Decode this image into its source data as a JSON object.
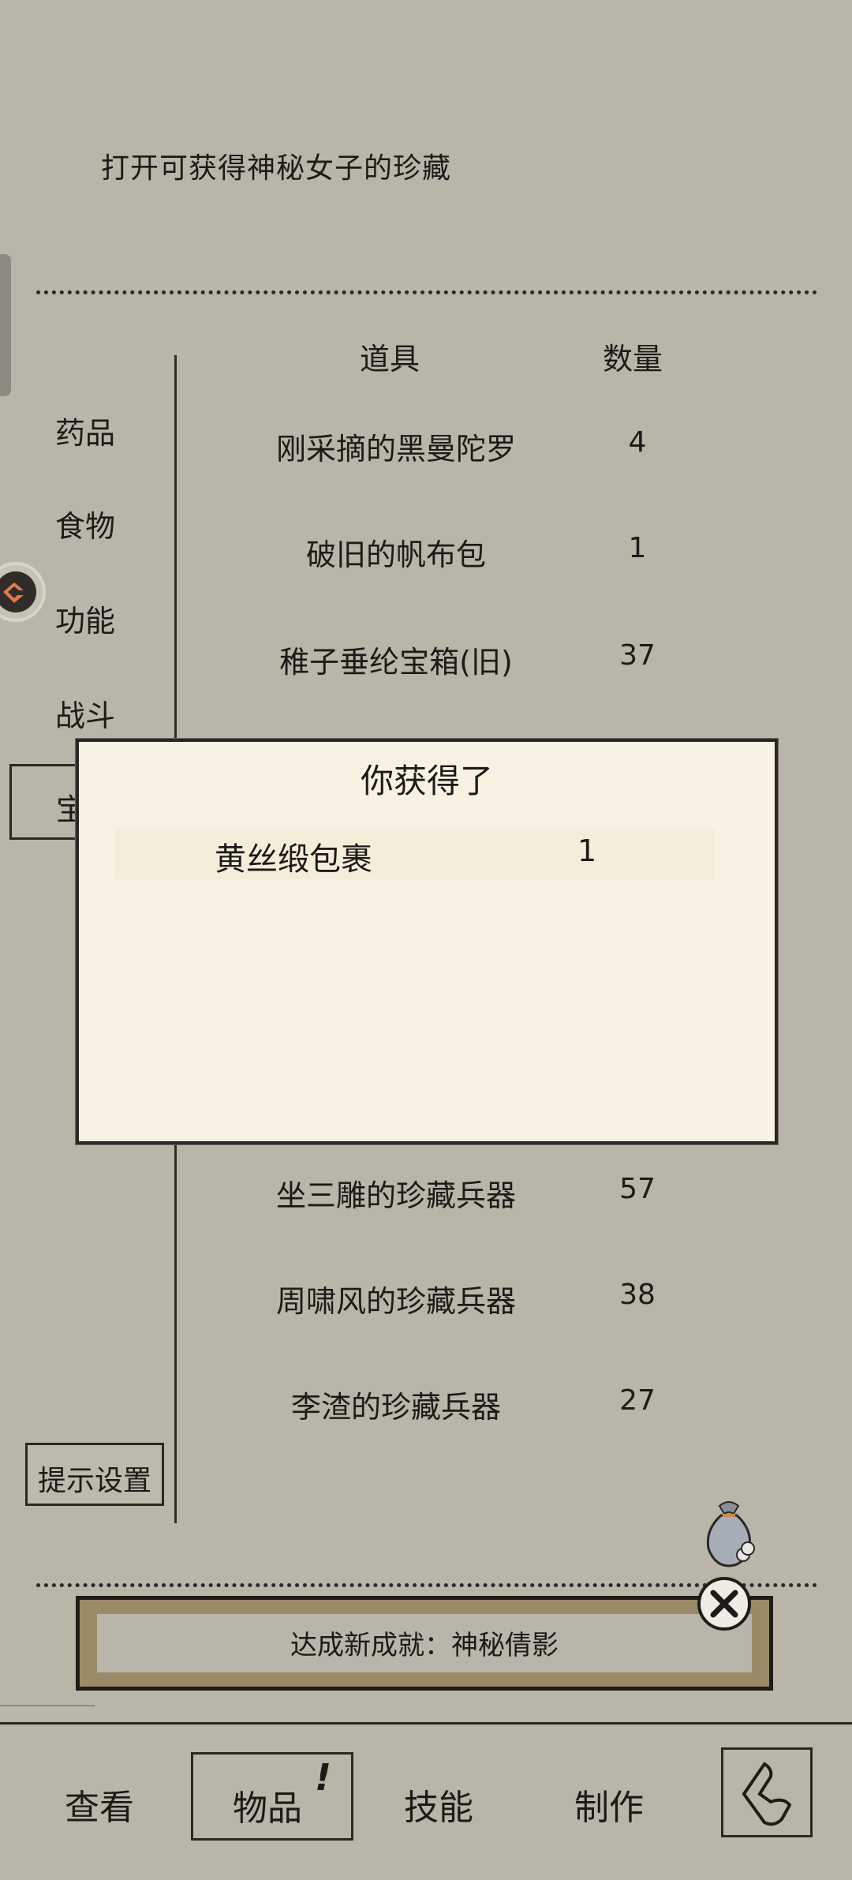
{
  "description": "打开可获得神秘女子的珍藏",
  "table": {
    "header_item": "道具",
    "header_qty": "数量",
    "rows_top": [
      {
        "name": "刚采摘的黑曼陀罗",
        "qty": "4"
      },
      {
        "name": "破旧的帆布包",
        "qty": "1"
      },
      {
        "name": "稚子垂纶宝箱(旧)",
        "qty": "37"
      }
    ],
    "rows_bottom": [
      {
        "name": "坐三雕的珍藏兵器",
        "qty": "57"
      },
      {
        "name": "周啸风的珍藏兵器",
        "qty": "38"
      },
      {
        "name": "李渣的珍藏兵器",
        "qty": "27"
      }
    ]
  },
  "categories": [
    "药品",
    "食物",
    "功能",
    "战斗",
    "宝"
  ],
  "popup": {
    "title": "你获得了",
    "item_name": "黄丝缎包裹",
    "item_qty": "1"
  },
  "hint_settings_label": "提示设置",
  "achievement": "达成新成就：神秘倩影",
  "nav": {
    "view": "查看",
    "items": "物品",
    "items_alert": "!",
    "skills": "技能",
    "craft": "制作"
  },
  "colors": {
    "background": "#b9b5a9",
    "popup": "#f8f2e2",
    "banner_frame": "#9b8a67"
  },
  "icons": [
    "back-arrow-icon",
    "close-x-icon",
    "money-bag-icon",
    "function-circle-icon"
  ]
}
